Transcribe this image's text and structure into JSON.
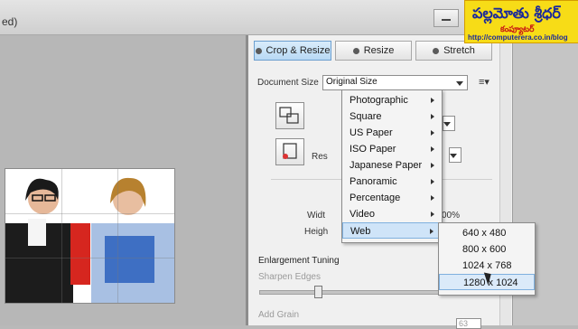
{
  "window": {
    "title_fragment": "ed)"
  },
  "tabs": [
    {
      "label": "Crop & Resize"
    },
    {
      "label": "Resize"
    },
    {
      "label": "Stretch"
    }
  ],
  "document_size": {
    "label": "Document Size",
    "selected": "Original Size"
  },
  "partial_labels": {
    "res": "Res",
    "width": "Widt",
    "height": "Heigh",
    "percent": "00%"
  },
  "menu": {
    "items": [
      {
        "label": "Photographic"
      },
      {
        "label": "Square"
      },
      {
        "label": "US Paper"
      },
      {
        "label": "ISO Paper"
      },
      {
        "label": "Japanese Paper"
      },
      {
        "label": "Panoramic"
      },
      {
        "label": "Percentage"
      },
      {
        "label": "Video"
      },
      {
        "label": "Web"
      }
    ],
    "highlighted": "Web"
  },
  "submenu": {
    "items": [
      {
        "label": "640 x 480"
      },
      {
        "label": "800 x 600"
      },
      {
        "label": "1024 x 768"
      },
      {
        "label": "1280 x 1024"
      }
    ],
    "highlighted": "1280 x 1024"
  },
  "enlargement": {
    "title": "Enlargement Tuning",
    "sharpen_label": "Sharpen Edges",
    "grain_label": "Add Grain",
    "grain_value": "63"
  },
  "logo": {
    "line1": "పల్లమోతు శ్రీధర్",
    "line2": "కంప్యూటర్",
    "url": "http://computerera.co.in/blog"
  },
  "colors": {
    "accent": "#b8d9f4",
    "highlight": "#cfe4f8",
    "logo_bg": "#f7dc17"
  }
}
